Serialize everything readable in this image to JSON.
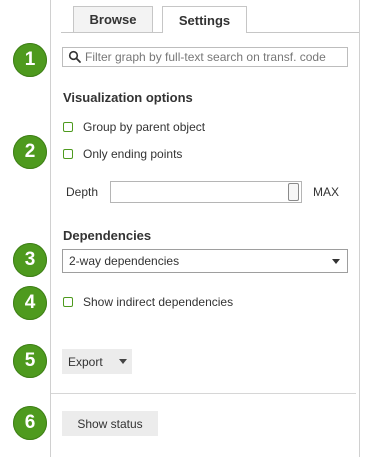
{
  "tabs": {
    "browse": "Browse",
    "settings": "Settings"
  },
  "badges": [
    "1",
    "2",
    "3",
    "4",
    "5",
    "6"
  ],
  "search": {
    "placeholder": "Filter graph by full-text search on transf. code",
    "value": ""
  },
  "visualization": {
    "title": "Visualization options",
    "group_by_parent": "Group by parent object",
    "only_ending_points": "Only ending points",
    "depth_label": "Depth",
    "max_label": "MAX",
    "depth_level": 1.0
  },
  "dependencies": {
    "title": "Dependencies",
    "selected": "2-way dependencies",
    "show_indirect": "Show indirect dependencies"
  },
  "export": {
    "label": "Export"
  },
  "status": {
    "label": "Show status"
  },
  "colors": {
    "badge": "#4e9a1e",
    "checkbox_border": "#4e9a1e"
  },
  "icons": {
    "search": "search-icon",
    "select_arrow": "chevron-down-icon",
    "export_arrow": "caret-down-icon"
  }
}
